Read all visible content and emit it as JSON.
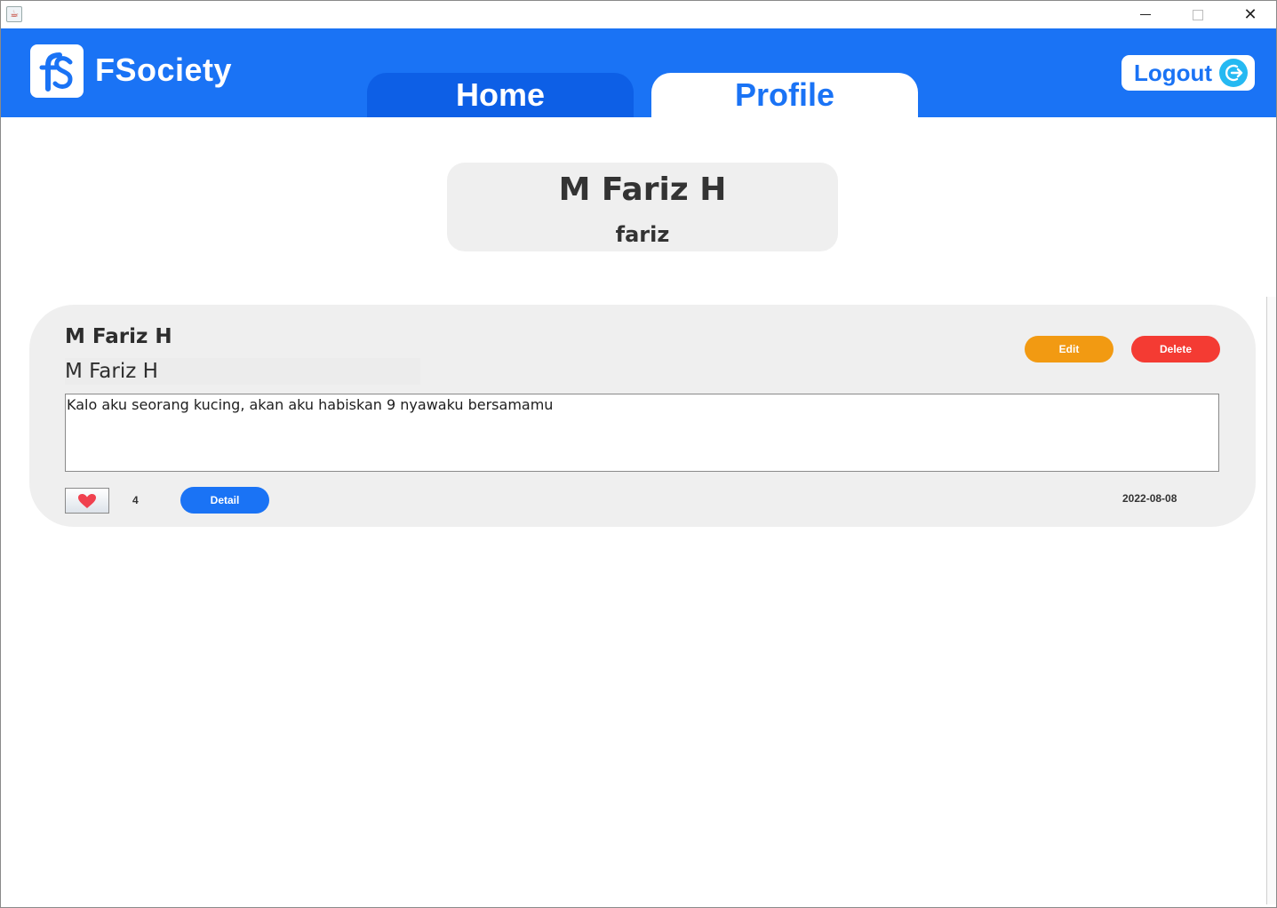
{
  "window": {
    "icon": "java-cup-icon",
    "controls": {
      "minimize": "minimize-icon",
      "maximize": "maximize-icon",
      "close_glyph": "✕"
    }
  },
  "header": {
    "app_name": "FSociety",
    "logo_icon": "fsociety-logo-icon",
    "tabs": [
      {
        "label": "Home",
        "active": false
      },
      {
        "label": "Profile",
        "active": true
      }
    ],
    "logout_label": "Logout",
    "logout_icon": "logout-arrow-icon"
  },
  "colors": {
    "brand_blue": "#1a73f5",
    "tab_inactive": "#0d5fe6",
    "edit": "#f29a12",
    "delete": "#f43b33",
    "card_bg": "#efefef",
    "heart": "#f0414f"
  },
  "profile": {
    "name": "M Fariz H",
    "username": "fariz"
  },
  "posts": [
    {
      "author": "M Fariz H",
      "title": "M Fariz H",
      "body": "Kalo aku seorang kucing, akan aku habiskan 9 nyawaku bersamamu",
      "edit_label": "Edit",
      "delete_label": "Delete",
      "like_icon": "heart-icon",
      "likes": "4",
      "detail_label": "Detail",
      "date": "2022-08-08"
    }
  ]
}
